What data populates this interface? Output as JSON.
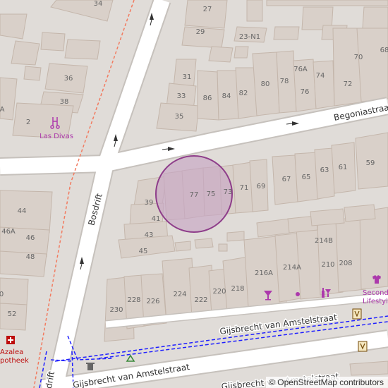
{
  "map": {
    "streets": {
      "bosdrift_north": "Bosdrift",
      "bosdrift_south": "Bosdrift",
      "begoniastraat": "Begoniastraat",
      "gijsbrecht_upper": "Gijsbrecht van Amstelstraat",
      "gijsbrecht_lower": "Gijsbrecht van Amstelstraat",
      "gijsbrecht_bottom": "Gijsbrecht van Amstelstraat"
    },
    "house_numbers": [
      "34",
      "27",
      "29",
      "23-N1",
      "68",
      "70",
      "31",
      "33",
      "35",
      "86",
      "84",
      "82",
      "80",
      "78",
      "76A",
      "76",
      "74",
      "72",
      "36",
      "38",
      "2",
      "A",
      "44",
      "46A",
      "46",
      "48",
      "0",
      "52",
      "39",
      "41",
      "43",
      "45",
      "77",
      "75",
      "73",
      "71",
      "69",
      "67",
      "65",
      "63",
      "61",
      "59",
      "214B",
      "216A",
      "214A",
      "210",
      "208",
      "224",
      "222",
      "220",
      "218",
      "228",
      "226",
      "230"
    ],
    "pois": {
      "las_divas": "Las Divas",
      "azalea_apotheek_1": "Azalea",
      "azalea_apotheek_2": "potheek",
      "second_lifestyle_1": "Second",
      "second_lifestyle_2": "Lifestyle"
    },
    "colors": {
      "background": "#e0dcd8",
      "building": "#d9d0c9",
      "building_edge": "#c4b6ab",
      "road": "#ffffff",
      "road_casing": "#c6c1bc",
      "poi": "#ac39ac",
      "pharmacy": "#bd0d0d",
      "footpath": "#1f1fff",
      "highlight_fill": "#c8a6c4",
      "highlight_stroke": "#8e3d8a"
    },
    "icons": [
      "hairdresser-icon",
      "pharmacy-icon",
      "bar-icon",
      "marketplace-icon",
      "liquor-icon",
      "clothes-icon",
      "bookmark-icon",
      "bookmark-icon",
      "recycling-icon",
      "waste-basket-icon",
      "oneway-arrow-icon"
    ]
  },
  "attribution": {
    "copy": "©",
    "link": "OpenStreetMap contributors"
  }
}
